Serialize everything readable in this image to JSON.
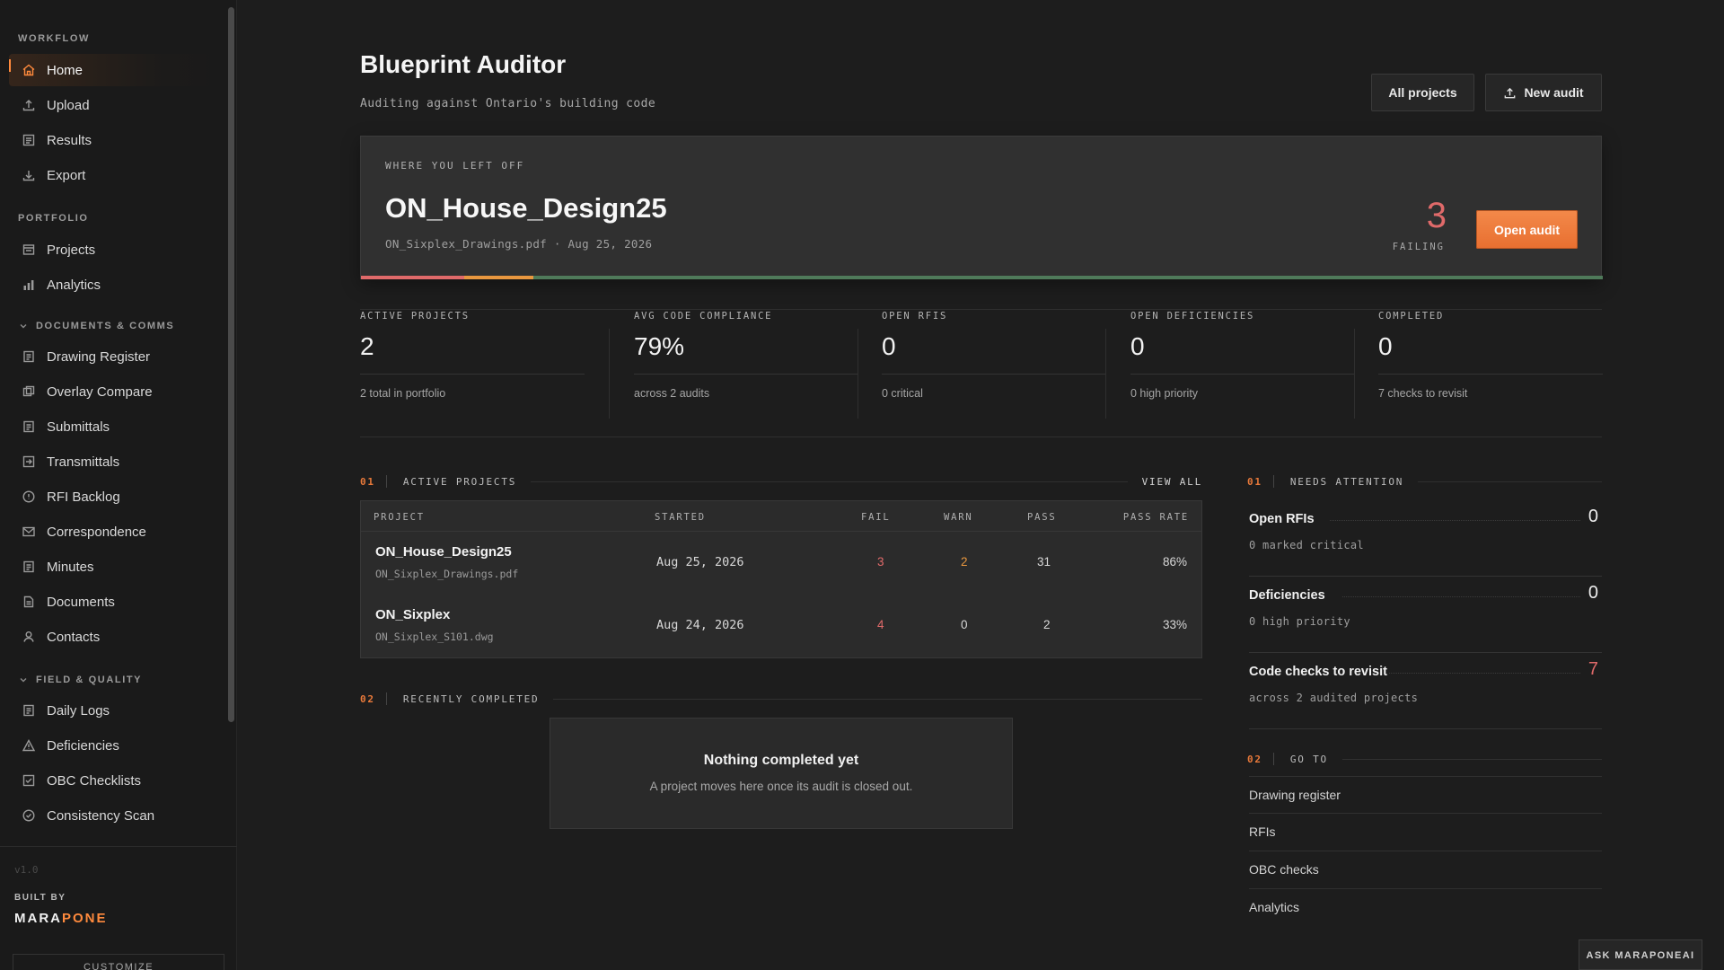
{
  "sidebar": {
    "sections": {
      "workflow": "WORKFLOW",
      "portfolio": "PORTFOLIO",
      "documents": "DOCUMENTS & COMMS",
      "field": "FIELD & QUALITY"
    },
    "items": [
      {
        "label": "Home",
        "icon": "home-icon"
      },
      {
        "label": "Upload",
        "icon": "upload-icon"
      },
      {
        "label": "Results",
        "icon": "results-icon"
      },
      {
        "label": "Export",
        "icon": "export-icon"
      },
      {
        "label": "Projects",
        "icon": "projects-icon"
      },
      {
        "label": "Analytics",
        "icon": "bar-chart-icon"
      },
      {
        "label": "Drawing Register",
        "icon": "document-icon"
      },
      {
        "label": "Overlay Compare",
        "icon": "overlay-icon"
      },
      {
        "label": "Submittals",
        "icon": "document-icon"
      },
      {
        "label": "Transmittals",
        "icon": "transmittal-icon"
      },
      {
        "label": "RFI Backlog",
        "icon": "info-circle-icon"
      },
      {
        "label": "Correspondence",
        "icon": "mail-icon"
      },
      {
        "label": "Minutes",
        "icon": "document-icon"
      },
      {
        "label": "Documents",
        "icon": "document-icon"
      },
      {
        "label": "Contacts",
        "icon": "user-icon"
      },
      {
        "label": "Daily Logs",
        "icon": "document-icon"
      },
      {
        "label": "Deficiencies",
        "icon": "warning-triangle-icon"
      },
      {
        "label": "OBC Checklists",
        "icon": "checklist-icon"
      },
      {
        "label": "Consistency Scan",
        "icon": "check-circle-icon"
      }
    ],
    "version": "v1.0",
    "built_by": "BUILT BY",
    "brand_a": "MARA",
    "brand_b": "PONE",
    "brand_accent": "#ff8a3d",
    "customize": "CUSTOMIZE"
  },
  "header": {
    "title": "Blueprint Auditor",
    "subtitle": "Auditing against Ontario's building code",
    "all_projects": "All projects",
    "new_audit": "New audit"
  },
  "hero": {
    "label": "WHERE YOU LEFT OFF",
    "project": "ON_House_Design25",
    "meta": "ON_Sixplex_Drawings.pdf · Aug 25, 2026",
    "failing_count": "3",
    "failing_label": "FAILING",
    "open_button": "Open audit",
    "progress": {
      "fail": 3,
      "warn": 2,
      "pass": 31
    },
    "colors": {
      "fail": "#e06a6a",
      "warn": "#e8973f",
      "pass": "#4f7a5a"
    }
  },
  "kpis": [
    {
      "label": "ACTIVE PROJECTS",
      "value": "2",
      "sub": "2 total in portfolio"
    },
    {
      "label": "AVG CODE COMPLIANCE",
      "value": "79%",
      "sub": "across 2 audits"
    },
    {
      "label": "OPEN RFIS",
      "value": "0",
      "sub": "0 critical"
    },
    {
      "label": "OPEN DEFICIENCIES",
      "value": "0",
      "sub": "0 high priority"
    },
    {
      "label": "COMPLETED",
      "value": "0",
      "sub": "7 checks to revisit"
    }
  ],
  "active_projects": {
    "num": "01",
    "title": "ACTIVE PROJECTS",
    "view_all": "VIEW ALL",
    "columns": [
      "PROJECT",
      "STARTED",
      "FAIL",
      "WARN",
      "PASS",
      "PASS RATE"
    ],
    "rows": [
      {
        "name": "ON_House_Design25",
        "file": "ON_Sixplex_Drawings.pdf",
        "started": "Aug 25, 2026",
        "fail": "3",
        "warn": "2",
        "pass": "31",
        "rate": "86%"
      },
      {
        "name": "ON_Sixplex",
        "file": "ON_Sixplex_S101.dwg",
        "started": "Aug 24, 2026",
        "fail": "4",
        "warn": "0",
        "pass": "2",
        "rate": "33%"
      }
    ]
  },
  "recently_completed": {
    "num": "02",
    "title": "RECENTLY COMPLETED",
    "empty_title": "Nothing completed yet",
    "empty_sub": "A project moves here once its audit is closed out."
  },
  "needs_attention": {
    "num": "01",
    "title": "NEEDS ATTENTION",
    "items": [
      {
        "label": "Open RFIs",
        "value": "0",
        "sub": "0 marked critical"
      },
      {
        "label": "Deficiencies",
        "value": "0",
        "sub": "0 high priority"
      },
      {
        "label": "Code checks to revisit",
        "value": "7",
        "sub": "across 2 audited projects"
      }
    ]
  },
  "go_to": {
    "num": "02",
    "title": "GO TO",
    "links": [
      "Drawing register",
      "RFIs",
      "OBC checks",
      "Analytics"
    ]
  },
  "ask_button": "ASK MARAPONEAI"
}
